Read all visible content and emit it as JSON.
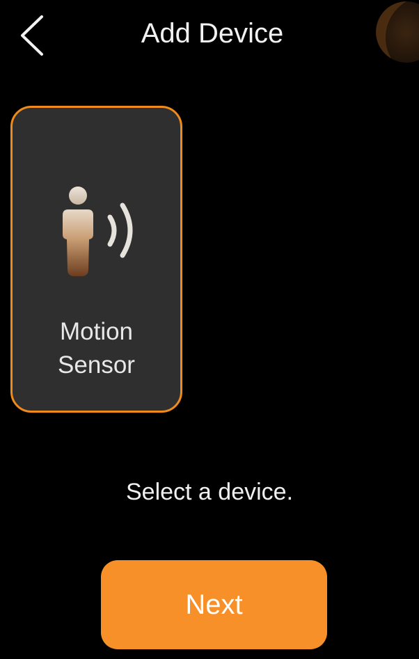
{
  "header": {
    "title": "Add Device",
    "back_icon": "chevron-left-icon"
  },
  "devices": [
    {
      "label_line1": "Motion",
      "label_line2": "Sensor",
      "icon": "motion-sensor-icon",
      "selected": true
    }
  ],
  "prompt": "Select a device.",
  "next_button": {
    "label": "Next"
  },
  "colors": {
    "accent": "#f8902a",
    "card_border": "#f08a1c",
    "card_background": "#2f2f2f",
    "background": "#000000"
  }
}
